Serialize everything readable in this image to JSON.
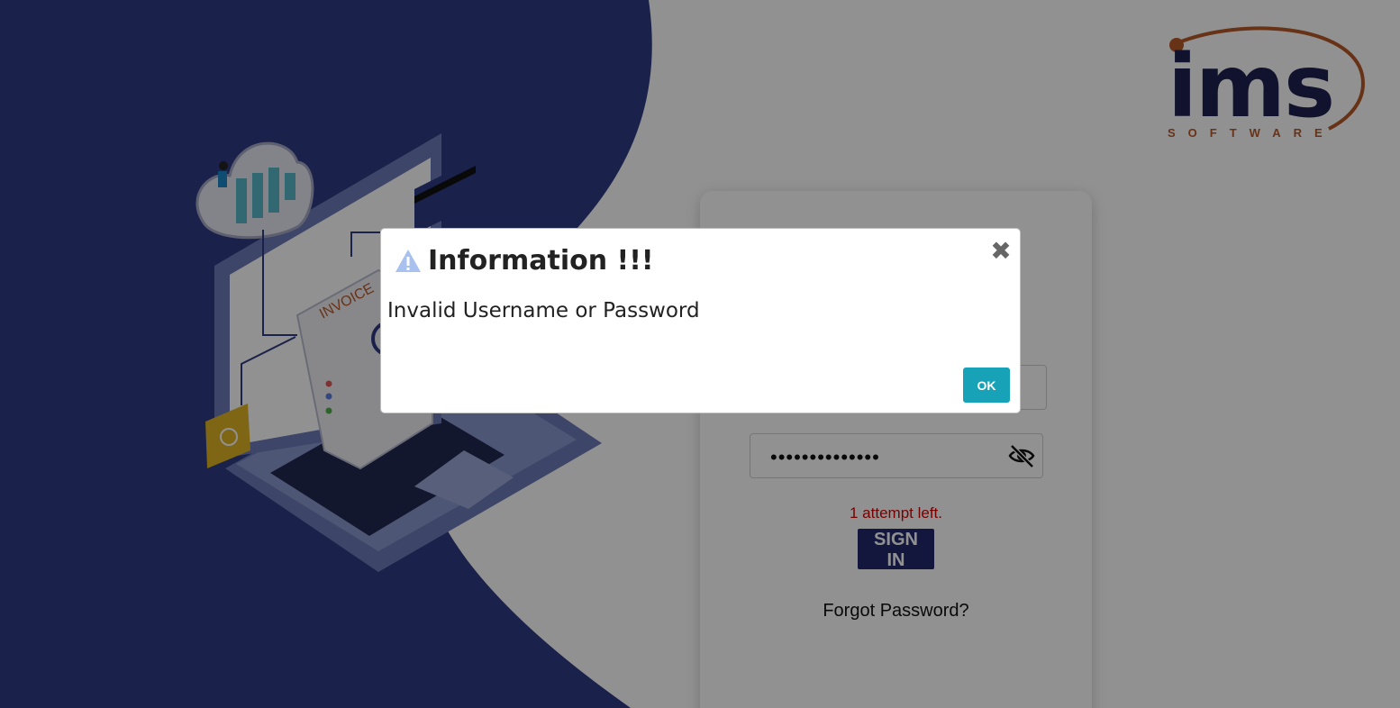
{
  "brand": {
    "name": "ims",
    "tagline": "SOFTWARE",
    "colors": {
      "navy": "#1e2150",
      "orange": "#b8582a"
    }
  },
  "illustration": {
    "invoice_label": "INVOICE"
  },
  "login": {
    "username_value": "",
    "password_value": "••••••••••••••",
    "password_toggle_icon": "eye-slash-icon",
    "attempts_text": "1 attempt left.",
    "signin_label": "SIGN IN",
    "forgot_label": "Forgot Password?",
    "colors": {
      "signin_bg": "#222a6e",
      "error": "#d40000"
    }
  },
  "dialog": {
    "icon": "warning-triangle-icon",
    "title": "Information !!!",
    "message": "Invalid Username or Password",
    "close_icon": "close-icon",
    "ok_label": "OK",
    "colors": {
      "ok_bg": "#17a2b8"
    }
  }
}
